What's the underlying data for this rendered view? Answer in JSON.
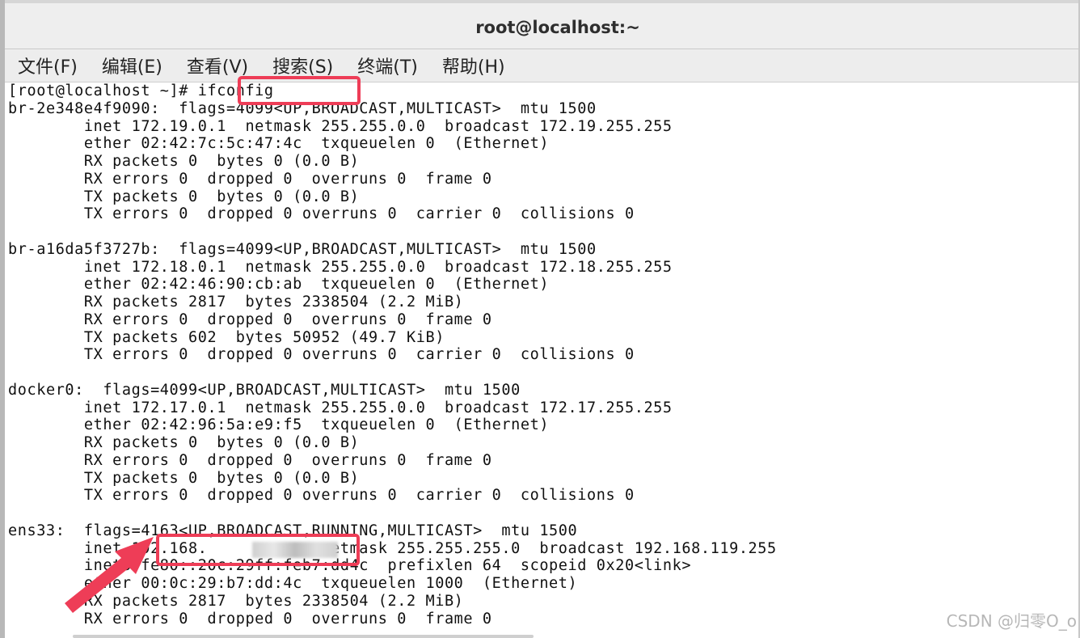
{
  "window": {
    "title": "root@localhost:~"
  },
  "menubar": {
    "items": [
      {
        "label": "文件(F)"
      },
      {
        "label": "编辑(E)"
      },
      {
        "label": "查看(V)"
      },
      {
        "label": "搜索(S)"
      },
      {
        "label": "终端(T)"
      },
      {
        "label": "帮助(H)"
      }
    ]
  },
  "terminal": {
    "lines": [
      "[root@localhost ~]# ifconfig",
      "br-2e348e4f9090:  flags=4099<UP,BROADCAST,MULTICAST>  mtu 1500",
      "        inet 172.19.0.1  netmask 255.255.0.0  broadcast 172.19.255.255",
      "        ether 02:42:7c:5c:47:4c  txqueuelen 0  (Ethernet)",
      "        RX packets 0  bytes 0 (0.0 B)",
      "        RX errors 0  dropped 0  overruns 0  frame 0",
      "        TX packets 0  bytes 0 (0.0 B)",
      "        TX errors 0  dropped 0 overruns 0  carrier 0  collisions 0",
      "",
      "br-a16da5f3727b:  flags=4099<UP,BROADCAST,MULTICAST>  mtu 1500",
      "        inet 172.18.0.1  netmask 255.255.0.0  broadcast 172.18.255.255",
      "        ether 02:42:46:90:cb:ab  txqueuelen 0  (Ethernet)",
      "        RX packets 2817  bytes 2338504 (2.2 MiB)",
      "        RX errors 0  dropped 0  overruns 0  frame 0",
      "        TX packets 602  bytes 50952 (49.7 KiB)",
      "        TX errors 0  dropped 0 overruns 0  carrier 0  collisions 0",
      "",
      "docker0:  flags=4099<UP,BROADCAST,MULTICAST>  mtu 1500",
      "        inet 172.17.0.1  netmask 255.255.0.0  broadcast 172.17.255.255",
      "        ether 02:42:96:5a:e9:f5  txqueuelen 0  (Ethernet)",
      "        RX packets 0  bytes 0 (0.0 B)",
      "        RX errors 0  dropped 0  overruns 0  frame 0",
      "        TX packets 0  bytes 0 (0.0 B)",
      "        TX errors 0  dropped 0 overruns 0  carrier 0  collisions 0",
      "",
      "ens33:  flags=4163<UP,BROADCAST,RUNNING,MULTICAST>  mtu 1500",
      "        inet 192.168.            netmask 255.255.255.0  broadcast 192.168.119.255",
      "        inet6 fe80::20c:29ff:feb7:dd4c  prefixlen 64  scopeid 0x20<link>",
      "        ether 00:0c:29:b7:dd:4c  txqueuelen 1000  (Ethernet)",
      "        RX packets 2817  bytes 2338504 (2.2 MiB)",
      "        RX errors 0  dropped 0  overruns 0  frame 0"
    ]
  },
  "annotations": {
    "highlight_color": "#ee3d57"
  },
  "watermark": {
    "text": "CSDN @归零O_o"
  }
}
